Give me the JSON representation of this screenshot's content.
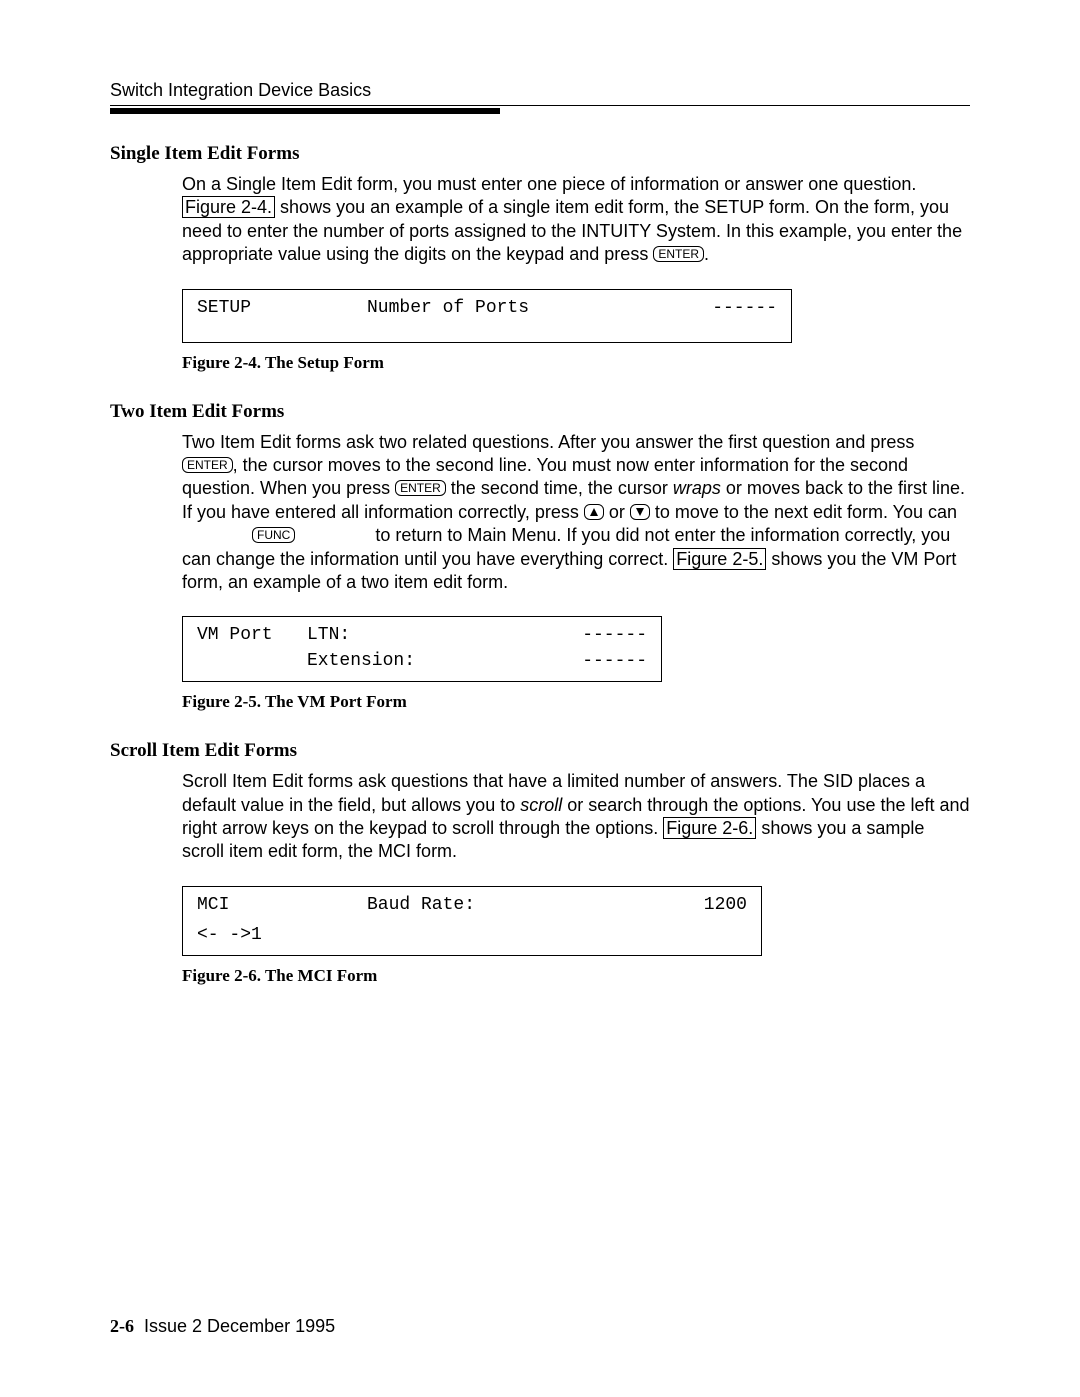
{
  "header": {
    "running_head": "Switch Integration Device Basics"
  },
  "keys": {
    "enter": "ENTER",
    "func": "FUNC"
  },
  "sections": {
    "single": {
      "title": "Single Item Edit Forms",
      "para_a": "On a Single Item Edit form, you must enter one piece of information or answer one question. ",
      "link": "Figure 2-4.",
      "para_b": " shows you an example of a single item edit form, the SETUP form. On the form, you need to enter the number of ports assigned to the INTUITY System. In this example, you enter the appropriate value using the digits on the keypad and press ",
      "para_c": ".",
      "form": {
        "col1": "SETUP",
        "col2": "Number of Ports",
        "col3": "------"
      },
      "caption": "Figure 2-4.   The Setup Form"
    },
    "two": {
      "title": "Two Item Edit Forms",
      "p1": "Two Item Edit forms ask two related questions. After you answer the first question and press ",
      "p2": ", the cursor moves to the second line. You must now enter information for the second question. When you press ",
      "p3": " the second time, the cursor ",
      "wraps": "wraps",
      "p4": " or moves back to the first line. If you have entered all information correctly, press ",
      "p5": " or ",
      "p6": " to move to the next edit form. You can ",
      "p7": " to return to Main Menu. If you did not enter the information correctly, you can change the information until you have everything correct. ",
      "link": "Figure 2-5.",
      "p8": " shows you the VM Port form, an example of a two item edit form.",
      "form": {
        "col1": "VM Port",
        "r1c2": "LTN:",
        "r2c2": "Extension:",
        "dashes": "------"
      },
      "caption": "Figure 2-5.   The VM Port Form"
    },
    "scroll": {
      "title": "Scroll Item Edit Forms",
      "p1": "Scroll Item Edit forms ask questions that have a limited number of answers. The SID places a default value in the field, but allows you to ",
      "scroll_word": "scroll",
      "p2": " or search through the options. You use the left and right arrow keys on the keypad to scroll through the options. ",
      "link": "Figure 2-6.",
      "p3": " shows you a sample scroll item edit form, the MCI form.",
      "form": {
        "r1c1": "MCI",
        "r1c2": "Baud Rate:",
        "r1c3": "1200",
        "r2": "<- ->1"
      },
      "caption": "Figure 2-6.   The MCI Form"
    }
  },
  "footer": {
    "page_num": "2-6",
    "issue": "Issue 2   December 1995"
  }
}
